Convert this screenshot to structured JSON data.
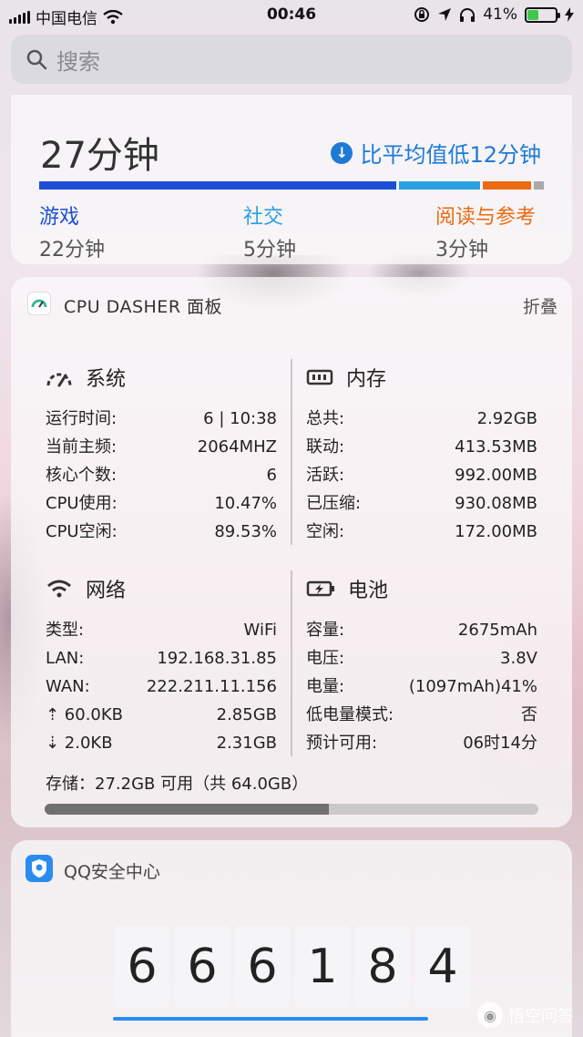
{
  "status_bar": {
    "carrier": "中国电信",
    "time": "00:46",
    "battery_percent": "41%",
    "battery_level": 0.41
  },
  "search": {
    "placeholder": "搜索"
  },
  "screen_time": {
    "total": "27分钟",
    "compare": "比平均值低12分钟",
    "categories": [
      {
        "name": "游戏",
        "value": "22分钟",
        "color": "#1d4fd6"
      },
      {
        "name": "社交",
        "value": "5分钟",
        "color": "#2aa0e0"
      },
      {
        "name": "阅读与参考",
        "value": "3分钟",
        "color": "#ec6a12"
      }
    ],
    "bar_segments": [
      {
        "share": 22,
        "color": "#1d4fd6"
      },
      {
        "share": 5,
        "color": "#2aa0e0"
      },
      {
        "share": 3,
        "color": "#ec6a12"
      },
      {
        "share": 0.6,
        "color": "#a9a9ad"
      }
    ]
  },
  "cpu_dasher": {
    "title": "CPU DASHER 面板",
    "fold": "折叠",
    "system": {
      "title": "系统",
      "rows": [
        {
          "k": "运行时间:",
          "v": "6 | 10:38"
        },
        {
          "k": "当前主频:",
          "v": "2064MHZ"
        },
        {
          "k": "核心个数:",
          "v": "6"
        },
        {
          "k": "CPU使用:",
          "v": "10.47%"
        },
        {
          "k": "CPU空闲:",
          "v": "89.53%"
        }
      ]
    },
    "memory": {
      "title": "内存",
      "rows": [
        {
          "k": "总共:",
          "v": "2.92GB"
        },
        {
          "k": "联动:",
          "v": "413.53MB"
        },
        {
          "k": "活跃:",
          "v": "992.00MB"
        },
        {
          "k": "已压缩:",
          "v": "930.08MB"
        },
        {
          "k": "空闲:",
          "v": "172.00MB"
        }
      ]
    },
    "network": {
      "title": "网络",
      "rows": [
        {
          "k": "类型:",
          "v": "WiFi"
        },
        {
          "k": "LAN:",
          "v": "192.168.31.85"
        },
        {
          "k": "WAN:",
          "v": "222.211.11.156"
        },
        {
          "k": "⇡ 60.0KB",
          "v": "2.85GB"
        },
        {
          "k": "⇣ 2.0KB",
          "v": "2.31GB"
        }
      ]
    },
    "battery": {
      "title": "电池",
      "rows": [
        {
          "k": "容量:",
          "v": "2675mAh"
        },
        {
          "k": "电压:",
          "v": "3.8V"
        },
        {
          "k": "电量:",
          "v": "(1097mAh)41%"
        },
        {
          "k": "低电量模式:",
          "v": "否"
        },
        {
          "k": "预计可用:",
          "v": "06时14分"
        }
      ]
    },
    "storage": "存储：27.2GB 可用（共 64.0GB）",
    "storage_used_fraction": 0.575
  },
  "qq": {
    "title": "QQ安全中心",
    "digits": [
      "6",
      "6",
      "6",
      "1",
      "8",
      "4"
    ]
  },
  "watermark": "悟空问答"
}
